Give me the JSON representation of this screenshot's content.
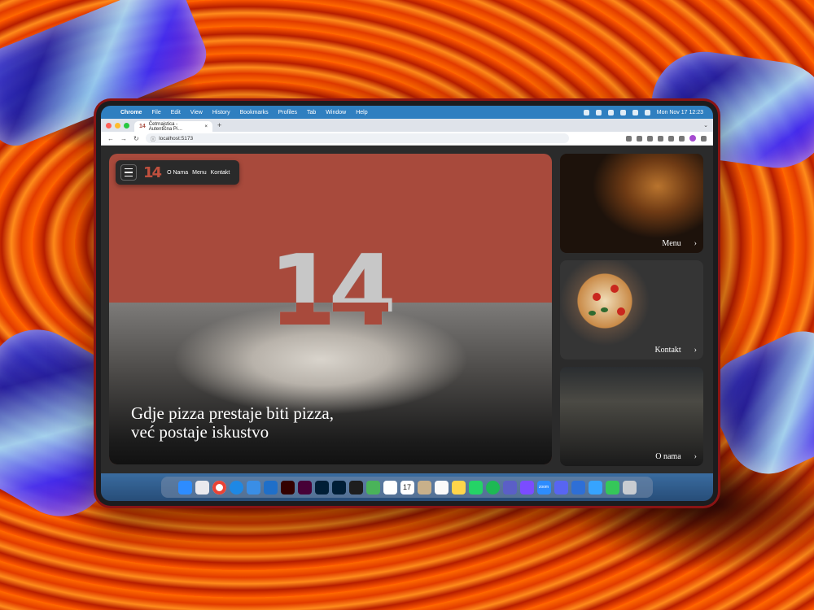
{
  "menubar": {
    "app_name": "Chrome",
    "items": [
      "File",
      "Edit",
      "View",
      "History",
      "Bookmarks",
      "Profiles",
      "Tab",
      "Window",
      "Help"
    ],
    "clock": "Mon Nov 17  12:23"
  },
  "browser": {
    "tab_title": "Četrnajstica - Autentična Pi…",
    "tab_favicon": "14",
    "url": "localhost:5173"
  },
  "site": {
    "logo": "14",
    "nav": [
      "O Nama",
      "Menu",
      "Kontakt"
    ],
    "hero_number": "14",
    "tagline_line1": "Gdje pizza prestaje biti pizza,",
    "tagline_line2": "već postaje iskustvo",
    "cards": [
      {
        "label": "Menu",
        "arrow": "›"
      },
      {
        "label": "Kontakt",
        "arrow": "›"
      },
      {
        "label": "O nama",
        "arrow": "›"
      }
    ]
  },
  "dock": {
    "apps": [
      "finder-icon",
      "launchpad-icon",
      "chrome-icon",
      "safari-icon",
      "mail-icon",
      "vscode-icon",
      "illustrator-icon",
      "xd-icon",
      "photoshop-icon",
      "lightroom-icon",
      "figma-icon",
      "maps-icon",
      "chatgpt-icon",
      "calendar-icon",
      "contacts-icon",
      "notes-icon",
      "reminders-icon",
      "whatsapp-icon",
      "spotify-icon",
      "teams-icon",
      "pixelmator-icon",
      "zoom-icon",
      "discord-icon",
      "preview-icon",
      "screensaver-icon",
      "facetime-icon",
      "trash-icon"
    ],
    "calendar_date": "17",
    "zoom_label": "zoom"
  },
  "colors": {
    "brand": "#a84a3c",
    "menubar": "#2f7fc0"
  }
}
